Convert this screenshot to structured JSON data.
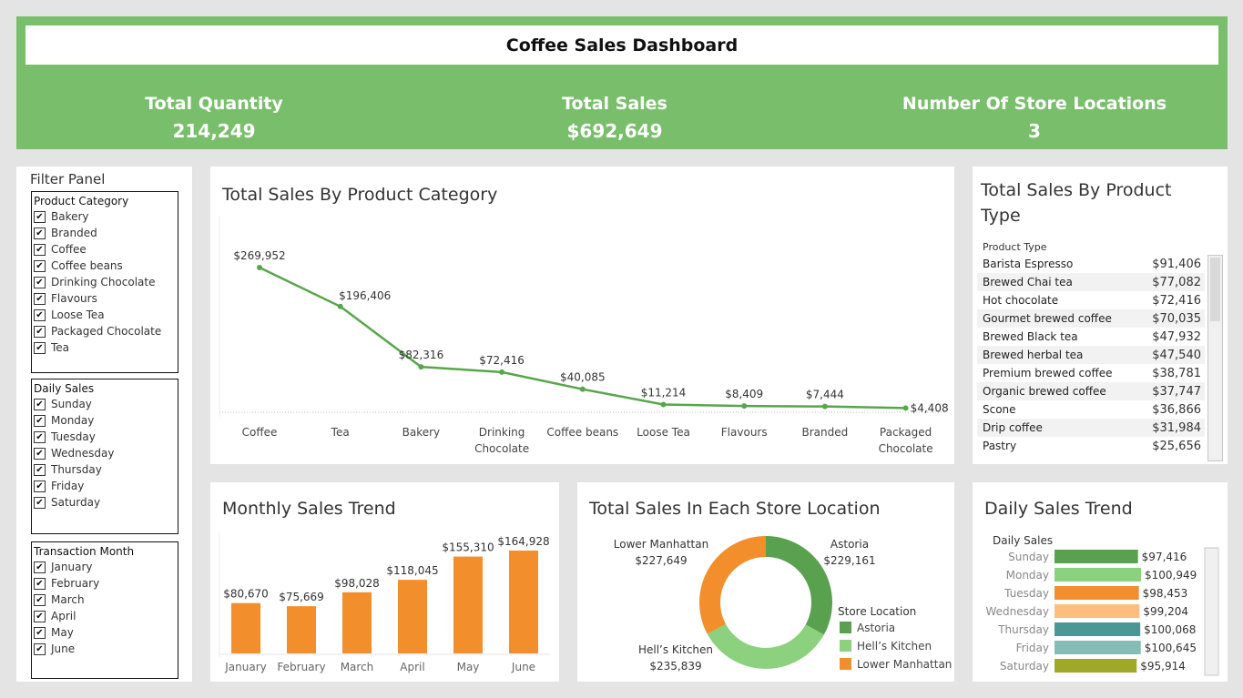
{
  "header": {
    "title": "Coffee Sales Dashboard",
    "kpis": [
      {
        "label": "Total Quantity",
        "value": "214,249"
      },
      {
        "label": "Total Sales",
        "value": "$692,649"
      },
      {
        "label": "Number Of Store Locations",
        "value": "3"
      }
    ]
  },
  "filter_panel": {
    "title": "Filter Panel",
    "groups": [
      {
        "title": "Product Category",
        "items": [
          "Bakery",
          "Branded",
          "Coffee",
          "Coffee beans",
          "Drinking Chocolate",
          "Flavours",
          "Loose Tea",
          "Packaged Chocolate",
          "Tea"
        ]
      },
      {
        "title": "Daily Sales",
        "items": [
          "Sunday",
          "Monday",
          "Tuesday",
          "Wednesday",
          "Thursday",
          "Friday",
          "Saturday"
        ]
      },
      {
        "title": "Transaction Month",
        "items": [
          "January",
          "February",
          "March",
          "April",
          "May",
          "June"
        ]
      }
    ],
    "checkmark": "✔"
  },
  "category_panel": {
    "title": "Total Sales By Product Category"
  },
  "type_panel": {
    "title": "Total Sales By Product Type",
    "column_header": "Product Type",
    "rows": [
      {
        "name": "Barista Espresso",
        "value": "$91,406"
      },
      {
        "name": "Brewed Chai tea",
        "value": "$77,082"
      },
      {
        "name": "Hot chocolate",
        "value": "$72,416"
      },
      {
        "name": "Gourmet brewed coffee",
        "value": "$70,035"
      },
      {
        "name": "Brewed Black tea",
        "value": "$47,932"
      },
      {
        "name": "Brewed herbal tea",
        "value": "$47,540"
      },
      {
        "name": "Premium brewed coffee",
        "value": "$38,781"
      },
      {
        "name": "Organic brewed coffee",
        "value": "$37,747"
      },
      {
        "name": "Scone",
        "value": "$36,866"
      },
      {
        "name": "Drip coffee",
        "value": "$31,984"
      },
      {
        "name": "Pastry",
        "value": "$25,656"
      }
    ]
  },
  "month_panel": {
    "title": "Monthly Sales Trend"
  },
  "store_panel": {
    "title": "Total Sales In Each Store Location"
  },
  "daily_panel": {
    "title": "Daily Sales Trend"
  },
  "colors": {
    "header_green": "#79bf6b",
    "line_green": "#57a64a",
    "bar_orange": "#f28e2b",
    "astoria": "#59a14f",
    "hells_kitchen": "#8cd17d",
    "lower_manhattan": "#f28e2b"
  },
  "chart_data": [
    {
      "type": "line",
      "categories": [
        "Coffee",
        "Tea",
        "Bakery",
        "Drinking Chocolate",
        "Coffee beans",
        "Loose Tea",
        "Flavours",
        "Branded",
        "Packaged Chocolate"
      ],
      "category_lines": [
        [
          "Coffee"
        ],
        [
          "Tea"
        ],
        [
          "Bakery"
        ],
        [
          "Drinking",
          "Chocolate"
        ],
        [
          "Coffee beans"
        ],
        [
          "Loose Tea"
        ],
        [
          "Flavours"
        ],
        [
          "Branded"
        ],
        [
          "Packaged",
          "Chocolate"
        ]
      ],
      "values": [
        269952,
        196406,
        82316,
        72416,
        40085,
        11214,
        8409,
        7444,
        4408
      ],
      "labels": [
        "$269,952",
        "$196,406",
        "$82,316",
        "$72,416",
        "$40,085",
        "$11,214",
        "$8,409",
        "$7,444",
        "$4,408"
      ],
      "title": "Total Sales By Product Category"
    },
    {
      "type": "bar",
      "categories": [
        "January",
        "February",
        "March",
        "April",
        "May",
        "June"
      ],
      "values": [
        80670,
        75669,
        98028,
        118045,
        155310,
        164928
      ],
      "labels": [
        "$80,670",
        "$75,669",
        "$98,028",
        "$118,045",
        "$155,310",
        "$164,928"
      ],
      "title": "Monthly Sales Trend"
    },
    {
      "type": "pie",
      "categories": [
        "Astoria",
        "Hell's Kitchen",
        "Lower Manhattan"
      ],
      "display_names": [
        "Astoria",
        "Hell’s Kitchen",
        "Lower Manhattan"
      ],
      "values": [
        229161,
        235839,
        227649
      ],
      "labels": [
        "$229,161",
        "$235,839",
        "$227,649"
      ],
      "legend_title": "Store Location",
      "title": "Total Sales In Each Store Location"
    },
    {
      "type": "bar",
      "orientation": "horizontal",
      "axis_title": "Daily Sales",
      "categories": [
        "Sunday",
        "Monday",
        "Tuesday",
        "Wednesday",
        "Thursday",
        "Friday",
        "Saturday"
      ],
      "values": [
        97416,
        100949,
        98453,
        99204,
        100068,
        100645,
        95914
      ],
      "labels": [
        "$97,416",
        "$100,949",
        "$98,453",
        "$99,204",
        "$100,068",
        "$100,645",
        "$95,914"
      ],
      "colors": [
        "#59a14f",
        "#8cd17d",
        "#f28e2b",
        "#ffbe7d",
        "#499894",
        "#86bcb6",
        "#a0a82a"
      ],
      "title": "Daily Sales Trend"
    }
  ]
}
